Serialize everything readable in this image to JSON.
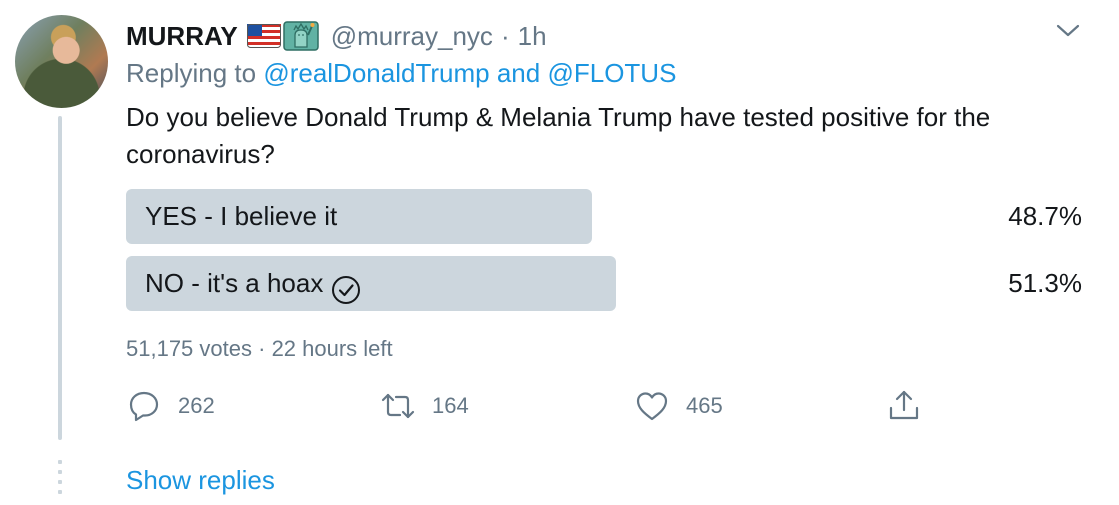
{
  "tweet": {
    "author_name": "MURRAY",
    "author_handle": "@murray_nyc",
    "separator": "·",
    "time": "1h",
    "name_emojis": [
      "us-flag-icon",
      "statue-of-liberty-icon"
    ],
    "replying_prefix": "Replying to",
    "replying_to_1": "@realDonaldTrump",
    "replying_and": "and",
    "replying_to_2": "@FLOTUS",
    "text": "Do you believe Donald Trump & Melania Trump have tested positive for the coronavirus?"
  },
  "poll": {
    "options": [
      {
        "label": "YES - I believe it",
        "percent_text": "48.7%",
        "fraction": 0.487,
        "winner": false
      },
      {
        "label": "NO - it's a hoax",
        "percent_text": "51.3%",
        "fraction": 0.513,
        "winner": true
      }
    ],
    "votes_text": "51,175 votes",
    "separator": "·",
    "time_left": "22 hours left"
  },
  "actions": {
    "reply_count": "262",
    "retweet_count": "164",
    "like_count": "465",
    "icons": [
      "reply-icon",
      "retweet-icon",
      "like-icon",
      "share-icon"
    ]
  },
  "show_replies_label": "Show replies",
  "colors": {
    "link_blue": "#1b95e0",
    "muted_gray": "#657786",
    "text_dark": "#14171a",
    "poll_bar": "#ccd6dd"
  }
}
